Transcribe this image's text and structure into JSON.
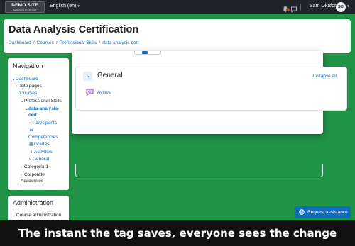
{
  "navbar": {
    "logo_main": "DEMO SITE",
    "logo_sub": "LEARNING PLATFORM",
    "language": "English (en)",
    "language_caret": "▾",
    "user_name": "Sam Okafor",
    "user_initials": "SO",
    "avatar_caret": "▾",
    "icons": [
      "bell-icon",
      "chat-icon"
    ]
  },
  "header": {
    "title": "Data Analysis Certification",
    "breadcrumb": [
      "Dashboard",
      "Courses",
      "Professional Skills",
      "data-analysis-cert"
    ]
  },
  "section": {
    "toggle_glyph": "⌄",
    "title": "General",
    "collapse_all": "Collapse all",
    "activities": [
      {
        "name": "Avisos",
        "icon": "forum-icon"
      }
    ]
  },
  "navigation": {
    "title": "Navigation",
    "items": [
      {
        "label": "Dashboard",
        "chevron": "⌄"
      },
      {
        "label": "Site pages",
        "chevron": "›"
      },
      {
        "label": "Courses",
        "chevron": "⌄"
      },
      {
        "label": "Professional Skills",
        "chevron": "⌄"
      },
      {
        "label": "data-analysis-",
        "label2": "cert",
        "chevron": "⌄"
      },
      {
        "label": "Participants",
        "chevron": "›"
      },
      {
        "label": "Competencies",
        "icon": "competencies-icon"
      },
      {
        "label": "Grades",
        "icon": "grades-icon"
      },
      {
        "label": "Activities",
        "icon": "info-icon"
      },
      {
        "label": "General",
        "chevron": "›"
      },
      {
        "label": "Categoría 1",
        "chevron": "›"
      },
      {
        "label": "Corporate",
        "label2": "Academies",
        "chevron": "›"
      }
    ]
  },
  "administration": {
    "title": "Administration",
    "items": [
      {
        "label": "Course administration",
        "chevron": "⌄"
      }
    ]
  },
  "assist": {
    "label": "Request assistance",
    "icon": "lifebuoy-icon"
  },
  "caption": {
    "text": "The instant the tag saves, everyone sees the change"
  },
  "colors": {
    "page_background": "#1f9346",
    "navbar": "#212529",
    "link": "#0f6cbf",
    "badge": "#ca3120",
    "caption_bg": "#111111"
  }
}
